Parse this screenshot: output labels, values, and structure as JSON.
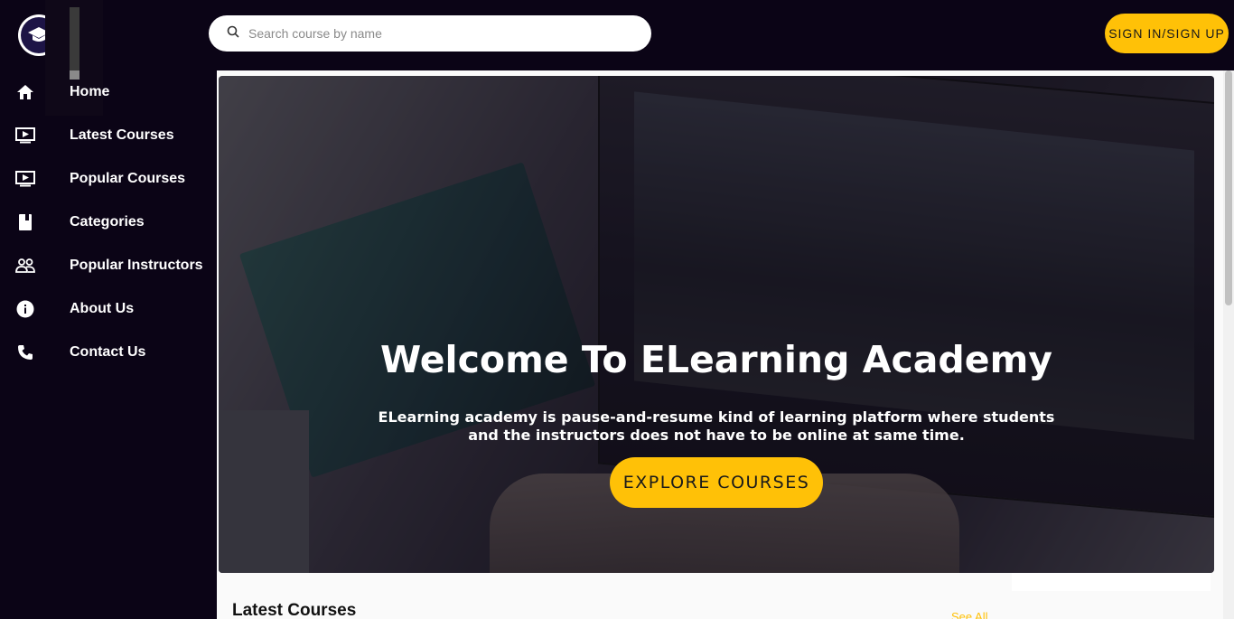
{
  "header": {
    "search_placeholder": "Search course by name",
    "signin_label": "SIGN IN/SIGN UP"
  },
  "sidebar": {
    "items": [
      {
        "label": "Home",
        "icon": "home-icon"
      },
      {
        "label": "Latest Courses",
        "icon": "video-icon"
      },
      {
        "label": "Popular Courses",
        "icon": "video-icon"
      },
      {
        "label": "Categories",
        "icon": "book-icon"
      },
      {
        "label": "Popular Instructors",
        "icon": "people-icon"
      },
      {
        "label": "About Us",
        "icon": "info-icon"
      },
      {
        "label": "Contact Us",
        "icon": "phone-icon"
      }
    ]
  },
  "hero": {
    "title": "Welcome To ELearning Academy",
    "subtitle": "ELearning academy is pause-and-resume kind of learning platform where students and the instructors does not have to be online at same time.",
    "cta_label": "EXPLORE COURSES"
  },
  "sections": {
    "latest_title": "Latest Courses",
    "see_all": "See All"
  },
  "colors": {
    "accent": "#ffc107",
    "background": "#0b0416"
  }
}
